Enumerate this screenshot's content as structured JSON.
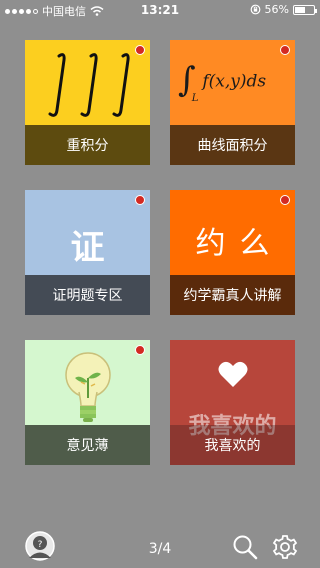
{
  "status_bar": {
    "carrier": "中国电信",
    "time": "13:21",
    "battery": "56%",
    "battery_level": 0.56
  },
  "tiles": [
    {
      "label": "重积分",
      "icon": "triple-integral-icon",
      "has_badge": true
    },
    {
      "label": "曲线面积分",
      "icon": "line-integral-icon",
      "has_badge": true,
      "formula": "f(x,y)ds",
      "formula_sub": "L"
    },
    {
      "label": "证明题专区",
      "icon": "proof-character-icon",
      "has_badge": true,
      "art_text": "证"
    },
    {
      "label": "约学霸真人讲解",
      "icon": "meetup-characters-icon",
      "has_badge": true,
      "art_text": "约么"
    },
    {
      "label": "意见薄",
      "icon": "lightbulb-icon",
      "has_badge": true
    },
    {
      "label": "我喜欢的",
      "icon": "heart-icon",
      "has_badge": false,
      "art_text": "我喜欢的"
    }
  ],
  "footer": {
    "page_indicator": "3/4",
    "avatar_icon": "help-avatar-icon",
    "search_icon": "search-icon",
    "settings_icon": "gear-icon"
  },
  "colors": {
    "background": "#8f8f8f",
    "badge": "#d32a22"
  }
}
